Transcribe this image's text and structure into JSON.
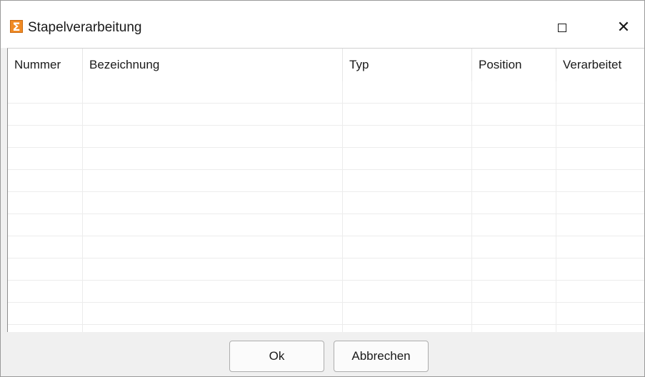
{
  "window": {
    "title": "Stapelverarbeitung",
    "app_icon": "sigma-icon",
    "maximize_icon": "maximize-icon",
    "close_icon": "close-icon",
    "close_glyph": "✕"
  },
  "grid": {
    "columns": [
      {
        "label": "Nummer"
      },
      {
        "label": "Bezeichnung"
      },
      {
        "label": "Typ"
      },
      {
        "label": "Position"
      },
      {
        "label": "Verarbeitet"
      }
    ],
    "rows": []
  },
  "buttons": {
    "ok_label": "Ok",
    "cancel_label": "Abbrechen"
  },
  "colors": {
    "app_icon_accent": "#f08a24"
  }
}
